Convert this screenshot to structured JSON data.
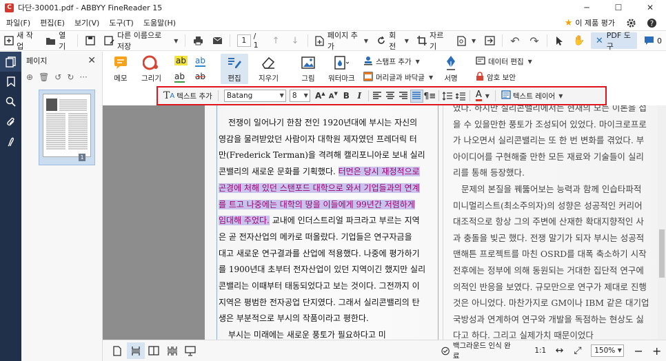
{
  "window": {
    "title": "다단-30001.pdf - ABBYY FineReader 15",
    "logo_text": "C"
  },
  "menu": {
    "items": [
      "파일(F)",
      "편집(E)",
      "보기(V)",
      "도구(T)",
      "도움말(H)"
    ],
    "rate_label": "이 제품 평가"
  },
  "toolbar": {
    "new_task": "새 작업",
    "open": "열기",
    "save_as": "다른 이름으로 저장",
    "page_current": "1",
    "page_total": "/ 1",
    "add_page": "페이지 추가",
    "rotate": "회전",
    "crop": "자르기",
    "pdf_tools": "PDF 도구",
    "comment_count": "0"
  },
  "sidebar": {
    "panel_title": "페이지",
    "thumb_number": "1"
  },
  "ribbon": {
    "memo": "메모",
    "draw": "그리기",
    "edit": "편집",
    "erase": "지우기",
    "picture": "그림",
    "watermark": "워터마크",
    "stamp_add": "스탬프 추가",
    "header_footer": "머리글과 바닥글",
    "sign": "서명",
    "data_edit": "데이터 편집",
    "password": "암호 보안",
    "hl_text": "ab"
  },
  "format_bar": {
    "add_text": "텍스트 추가",
    "font_name": "Batang",
    "font_size": "8",
    "text_layer": "텍스트 레이어"
  },
  "document": {
    "left_lines": [
      "전쟁이 일어나기 한참 전인 1920년대에 부시는 자신의",
      "영감을 물려받았던 사람이자 대학원 제자였던 프레더릭 터",
      "만(Frederick Terman)을 격려해 캘리포니아로 보내 실리",
      "콘밸리의 새로운 문화를 기획했다. ",
      "곤경에 처해 있던 스탠포드 대학으로 와서 기업들과의 연계",
      "를 트고 나중에는 대학의 땅을 이들에게 99년간 저렴하게",
      "임대해 주었다.",
      "은 곧 전자산업의 메카로 떠올랐다. 기업들은 연구자금을",
      "대고 새로운 연구결과를 산업에 적용했다. 나중에 평가하기",
      "를 1900년대 초부터 전자산업이 있던 지역이긴 했지만 실리",
      "콘밸리는 이때부터 태동되었다고 보는 것이다. 그전까지 이",
      "지역은 평범한 전자공업 단지였다. 그래서 실리콘밸리의 탄",
      "생은 부분적으로 부시의 작품이라고 평한다.",
      "부시는 미래에는 새로운 풍토가 필요하다고 미"
    ],
    "left_line4_hl": "터먼은 당시 재정적으로",
    "left_line7_rest": "교내에 인더스트리얼 파크라고 부르는 지역",
    "right_lines": [
      "였다. 하지만 실리콘밸리에서는 현재의 모든 이론을 접",
      "을 수 있을만한 풍토가 조성되어 있었다. 마이크로프로",
      "가 나오면서 실리콘밸리는 또 한 번 변화를 겪었다. 부",
      "아이디어를 구현해줄 만한 모든 재료와 기술들이 실리",
      "리를 통해 등장했다.",
      "문제의 본질을 꿰뚫어보는 능력과 함께 인습타파적",
      "미니멀리스트(최소주의자)의 성향은 성공적인 커리어",
      "대조적으로 항상 그의 주변에 산재한 확대지향적인 사",
      "과 충돌을 빚곤 했다. 전쟁 말기가 되자 부시는 성공적",
      "맨해튼 프로젝트를 마친 OSRD를 대폭 축소하기 시작",
      "전후에는 정부에 의해 동원되는 거대한 집단적 연구에",
      "의적인 반응을 보였다. 규모만으로 연구가 제대로 진행",
      "것은 아니었다. 마찬가지로 GM이나 IBM 같은 대기업",
      "국방성과 연계하여 연구와 개발을 독점하는 현상도 싫",
      "다고 하다. 그리고 실제가치 때문이었다"
    ]
  },
  "status": {
    "recognition": "백그라운드 인식 완료",
    "ratio": "1:1",
    "zoom": "150%"
  }
}
